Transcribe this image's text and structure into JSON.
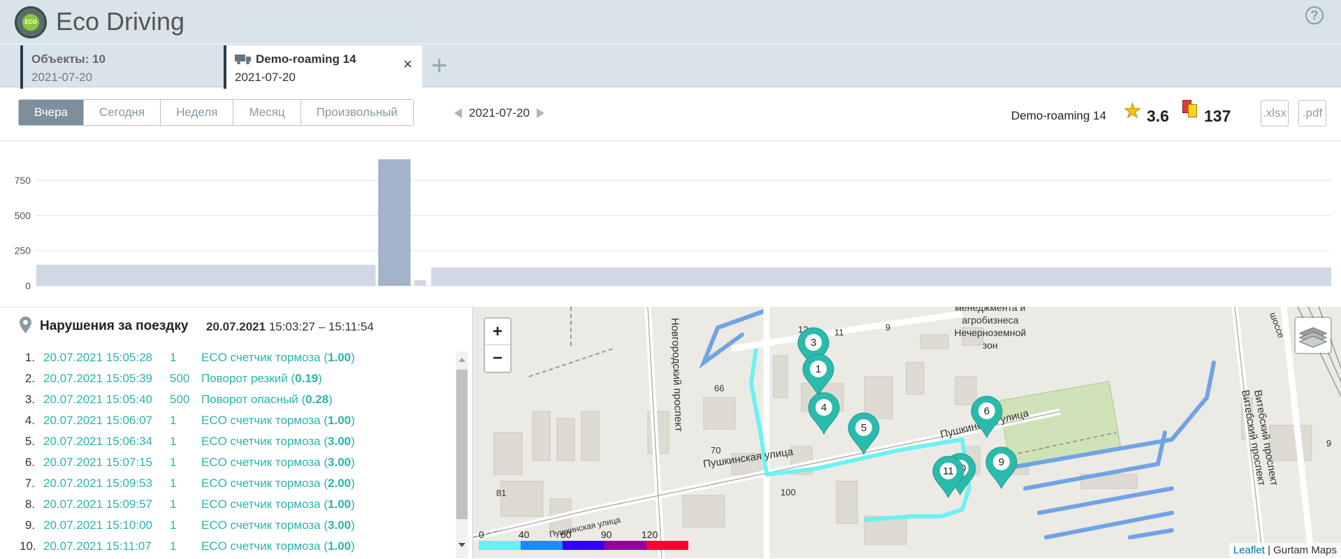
{
  "header": {
    "logo_text": "ECO",
    "title": "Eco Driving",
    "help": "?"
  },
  "tabs": [
    {
      "title": "Объекты: 10",
      "date": "2021-07-20",
      "active": false
    },
    {
      "title": "Demo-roaming 14",
      "date": "2021-07-20",
      "active": true,
      "close": "×"
    }
  ],
  "add_tab": "+",
  "toolbar": {
    "periods": [
      "Вчера",
      "Сегодня",
      "Неделя",
      "Месяц",
      "Произвольный"
    ],
    "active_period": "Вчера",
    "date": "2021-07-20",
    "object_name": "Demo-roaming 14",
    "rating": "3.6",
    "violations_count": "137",
    "export_xlsx": ".xlsx",
    "export_pdf": ".pdf"
  },
  "chart_data": {
    "type": "bar",
    "y_ticks": [
      "0",
      "250",
      "500",
      "750"
    ],
    "ylim": [
      0,
      900
    ],
    "grid": true,
    "bars": [
      {
        "from": 0.0,
        "to": 0.262,
        "value": 150
      },
      {
        "from": 0.264,
        "to": 0.289,
        "value": 900
      },
      {
        "from": 0.292,
        "to": 0.301,
        "value": 40
      },
      {
        "from": 0.305,
        "to": 1.0,
        "value": 130
      }
    ]
  },
  "violations": {
    "title": "Нарушения за поездку",
    "date": "20.07.2021",
    "time_range": "15:03:27 – 15:11:54",
    "items": [
      {
        "num": "1.",
        "time": "20.07.2021 15:05:28",
        "code": "1",
        "desc": "ECO счетчик тормоза (",
        "value": "1.00",
        "close": ")"
      },
      {
        "num": "2.",
        "time": "20.07.2021 15:05:39",
        "code": "500",
        "desc": "Поворот резкий (",
        "value": "0.19",
        "close": ")"
      },
      {
        "num": "3.",
        "time": "20.07.2021 15:05:40",
        "code": "500",
        "desc": "Поворот опасный (",
        "value": "0.28",
        "close": ")"
      },
      {
        "num": "4.",
        "time": "20.07.2021 15:06:07",
        "code": "1",
        "desc": "ECO счетчик тормоза (",
        "value": "1.00",
        "close": ")"
      },
      {
        "num": "5.",
        "time": "20.07.2021 15:06:34",
        "code": "1",
        "desc": "ECO счетчик тормоза (",
        "value": "3.00",
        "close": ")"
      },
      {
        "num": "6.",
        "time": "20.07.2021 15:07:15",
        "code": "1",
        "desc": "ECO счетчик тормоза (",
        "value": "3.00",
        "close": ")"
      },
      {
        "num": "7.",
        "time": "20.07.2021 15:09:53",
        "code": "1",
        "desc": "ECO счетчик тормоза (",
        "value": "2.00",
        "close": ")"
      },
      {
        "num": "8.",
        "time": "20.07.2021 15:09:57",
        "code": "1",
        "desc": "ECO счетчик тормоза (",
        "value": "1.00",
        "close": ")"
      },
      {
        "num": "9.",
        "time": "20.07.2021 15:10:00",
        "code": "1",
        "desc": "ECO счетчик тормоза (",
        "value": "3.00",
        "close": ")"
      },
      {
        "num": "10.",
        "time": "20.07.2021 15:11:07",
        "code": "1",
        "desc": "ECO счетчик тормоза (",
        "value": "1.00",
        "close": ")"
      }
    ]
  },
  "map": {
    "zoom_in": "+",
    "zoom_out": "−",
    "labels": {
      "street_1": "Пушкинская улица",
      "street_2": "Пушкинская улица",
      "street_3": "Пушкинская улица",
      "prospect_1": "Новгородский проспект",
      "prospect_2": "Витебский проспект",
      "prospect_3": "Витебский проспект",
      "institute": [
        "менеджмента и",
        "агробизнеса",
        "Нечерноземной",
        "зон"
      ],
      "highway": "шоссе",
      "n66": "66",
      "n70": "70",
      "n81": "81",
      "n100": "100",
      "n12": "12",
      "n11": "11",
      "n9a": "9",
      "n9b": "9"
    },
    "markers": [
      "3",
      "1",
      "4",
      "5",
      "6",
      "9",
      "10",
      "11"
    ],
    "speed_legend": {
      "ticks": [
        "0",
        "40",
        "60",
        "90",
        "120"
      ],
      "colors": [
        "#5ff3f3",
        "#1a8cff",
        "#3300ff",
        "#990099",
        "#ff0033"
      ]
    },
    "attribution_leaflet": "Leaflet",
    "attribution_sep": " | ",
    "attribution_maps": "Gurtam Maps"
  }
}
